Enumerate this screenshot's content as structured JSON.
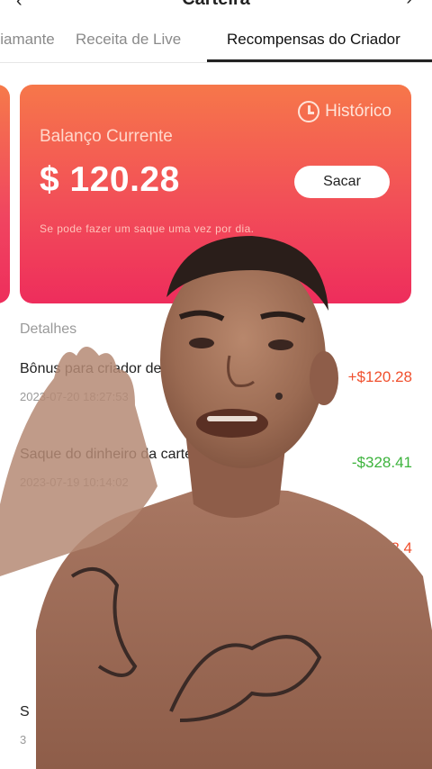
{
  "header": {
    "back_icon": "‹",
    "title": "Carteira",
    "menu_icon": "›"
  },
  "tabs": [
    {
      "label": "Diamante"
    },
    {
      "label": "Receita de Live"
    },
    {
      "label": "Recompensas do Criador"
    }
  ],
  "balance_card": {
    "history_label": "Histórico",
    "balance_label": "Balanço Currente",
    "amount": "$ 120.28",
    "withdraw_label": "Sacar",
    "note": "Se pode fazer um saque uma vez por dia."
  },
  "details": {
    "title": "Detalhes",
    "items": [
      {
        "title": "Bônus para criador de conteúdo",
        "date": "2023-07-20 18:27:53",
        "amount": "+$120.28"
      },
      {
        "title": "Saque do dinheiro da carteira",
        "date": "2023-07-19 10:14:02",
        "amount": "-$328.41"
      },
      {
        "title": "",
        "date": "",
        "amount": "+$328.4"
      },
      {
        "title": "S",
        "date": "3",
        "amount": ""
      }
    ]
  },
  "colors": {
    "card_top": "#f6774a",
    "card_bottom": "#ee2d5c",
    "positive": "#f0502e",
    "negative": "#3db33d"
  }
}
